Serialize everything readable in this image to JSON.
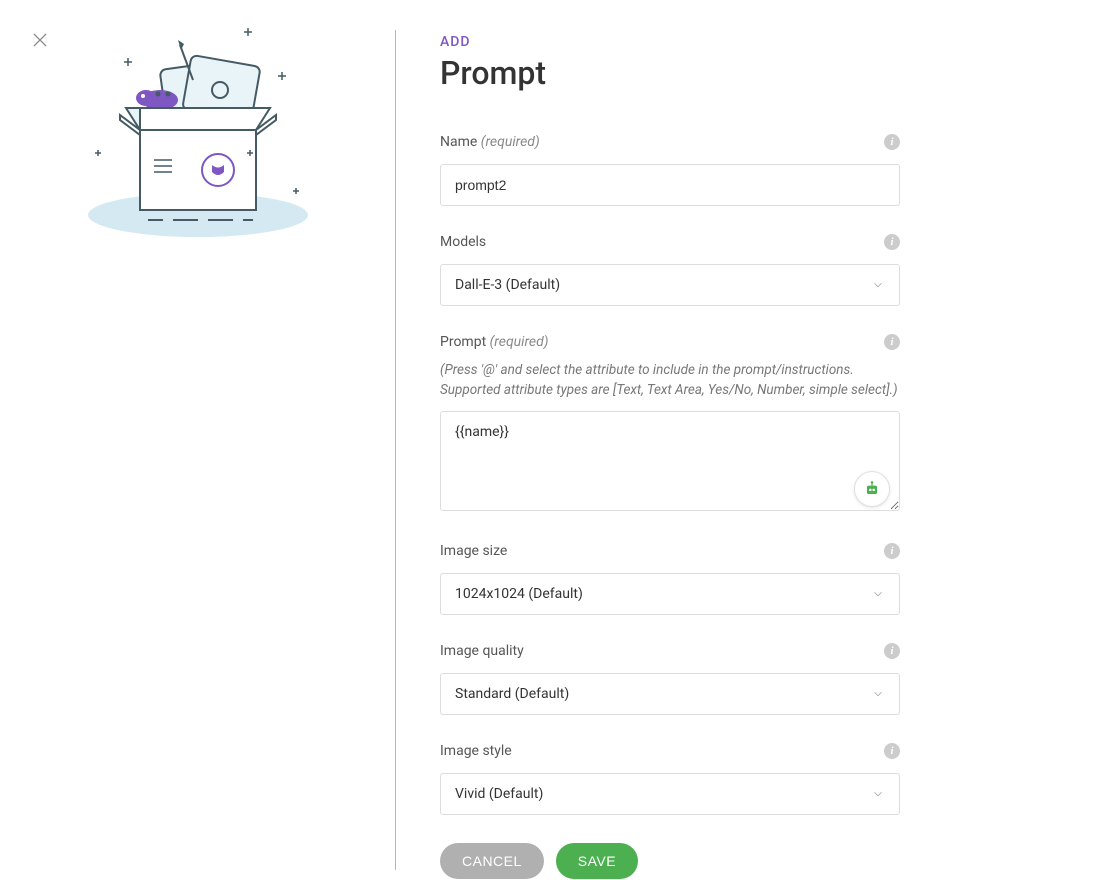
{
  "header": {
    "eyebrow": "ADD",
    "title": "Prompt"
  },
  "fields": {
    "name": {
      "label": "Name",
      "required_text": "(required)",
      "value": "prompt2"
    },
    "models": {
      "label": "Models",
      "value": "Dall-E-3 (Default)"
    },
    "prompt": {
      "label": "Prompt",
      "required_text": "(required)",
      "hint": "(Press '@' and select the attribute to include in the prompt/instructions. Supported attribute types are [Text, Text Area, Yes/No, Number, simple select].)",
      "value": "{{name}}"
    },
    "image_size": {
      "label": "Image size",
      "value": "1024x1024 (Default)"
    },
    "image_quality": {
      "label": "Image quality",
      "value": "Standard (Default)"
    },
    "image_style": {
      "label": "Image style",
      "value": "Vivid (Default)"
    }
  },
  "buttons": {
    "cancel": "CANCEL",
    "save": "SAVE"
  }
}
